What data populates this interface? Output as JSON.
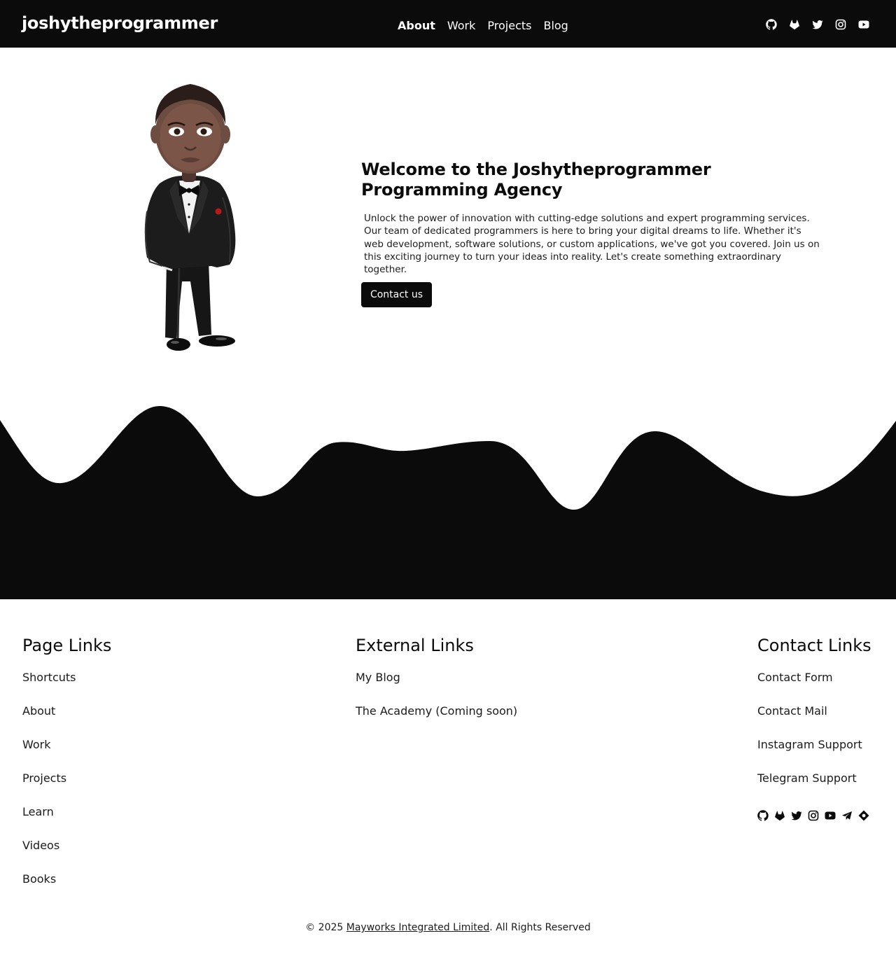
{
  "header": {
    "brand": "joshytheprogrammer",
    "nav": [
      "About",
      "Work",
      "Projects",
      "Blog"
    ],
    "active_nav": "About",
    "social_icons": [
      "github-icon",
      "gitlab-icon",
      "twitter-icon",
      "instagram-icon",
      "youtube-icon"
    ]
  },
  "hero": {
    "title": "Welcome to the Joshytheprogrammer Programming Agency",
    "paragraph": "Unlock the power of innovation with cutting-edge solutions and expert programming services. Our team of dedicated programmers is here to bring your digital dreams to life. Whether it's web development, software solutions, or custom applications, we've got you covered. Join us on this exciting journey to turn your ideas into reality. Let's create something extraordinary together.",
    "cta": "Contact us"
  },
  "footer": {
    "page_links": {
      "heading": "Page Links",
      "items": [
        "Shortcuts",
        "About",
        "Work",
        "Projects",
        "Learn",
        "Videos",
        "Books"
      ]
    },
    "external_links": {
      "heading": "External Links",
      "items": [
        "My Blog",
        "The Academy (Coming soon)"
      ]
    },
    "contact_links": {
      "heading": "Contact Links",
      "items": [
        "Contact Form",
        "Contact Mail",
        "Instagram Support",
        "Telegram Support"
      ]
    },
    "social_icons": [
      "github-icon",
      "gitlab-icon",
      "twitter-icon",
      "instagram-icon",
      "youtube-icon",
      "telegram-icon",
      "hashnode-icon"
    ],
    "copyright_prefix": "© 2025 ",
    "copyright_company": "Mayworks Integrated Limited",
    "copyright_suffix": ". All Rights Reserved"
  },
  "colors": {
    "dark": "#0b0b0b",
    "background": "#ffffff"
  }
}
